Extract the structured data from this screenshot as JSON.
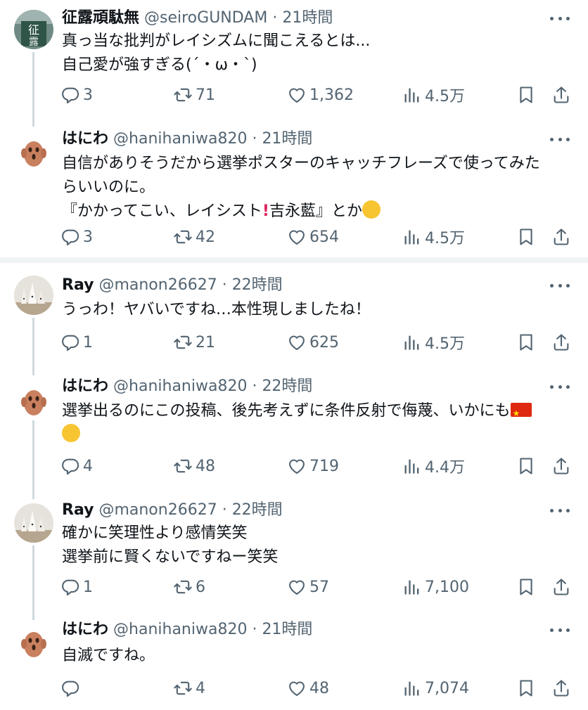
{
  "tweets": [
    {
      "name": "征露頑駄無",
      "handle": "@seiroGUNDAM",
      "time": "21時間",
      "lines": [
        "真っ当な批判がレイシズムに聞こえるとは...",
        "自己愛が強すぎる(´・ω・`)"
      ],
      "replies": "3",
      "retweets": "71",
      "likes": "1,362",
      "views": "4.5万",
      "avatar": "seiro"
    },
    {
      "name": "はにわ",
      "handle": "@hanihaniwa820",
      "time": "21時間",
      "lines": [
        "自信がありそうだから選挙ポスターのキャッチフレーズで使ってみた",
        "らいいのに。",
        "『かかってこい、レイシスト",
        "吉永藍』とか"
      ],
      "replies": "3",
      "retweets": "42",
      "likes": "654",
      "views": "4.5万",
      "avatar": "haniwa"
    },
    {
      "name": "Ray",
      "handle": "@manon26627",
      "time": "22時間",
      "lines": [
        "うっわ！ヤバいですね…本性現しましたね！"
      ],
      "replies": "1",
      "retweets": "21",
      "likes": "625",
      "views": "4.5万",
      "avatar": "ray"
    },
    {
      "name": "はにわ",
      "handle": "@hanihaniwa820",
      "time": "22時間",
      "lines": [
        "選挙出るのにこの投稿、後先考えずに条件反射で侮蔑、いかにも"
      ],
      "replies": "4",
      "retweets": "48",
      "likes": "719",
      "views": "4.4万",
      "avatar": "haniwa"
    },
    {
      "name": "Ray",
      "handle": "@manon26627",
      "time": "22時間",
      "lines": [
        "確かに笑理性より感情笑笑",
        "選挙前に賢くないですねー笑笑"
      ],
      "replies": "1",
      "retweets": "6",
      "likes": "57",
      "views": "7,100",
      "avatar": "ray"
    },
    {
      "name": "はにわ",
      "handle": "@hanihaniwa820",
      "time": "21時間",
      "lines": [
        "自滅ですね。"
      ],
      "replies": "",
      "retweets": "4",
      "likes": "48",
      "views": "7,074",
      "avatar": "haniwa"
    }
  ],
  "colors": {
    "text": "#0f1419",
    "muted": "#536471",
    "thread": "#cfd9de",
    "divider": "#eff3f4"
  },
  "icons": [
    "reply-icon",
    "retweet-icon",
    "like-icon",
    "views-icon",
    "bookmark-icon",
    "share-icon",
    "more-icon"
  ]
}
